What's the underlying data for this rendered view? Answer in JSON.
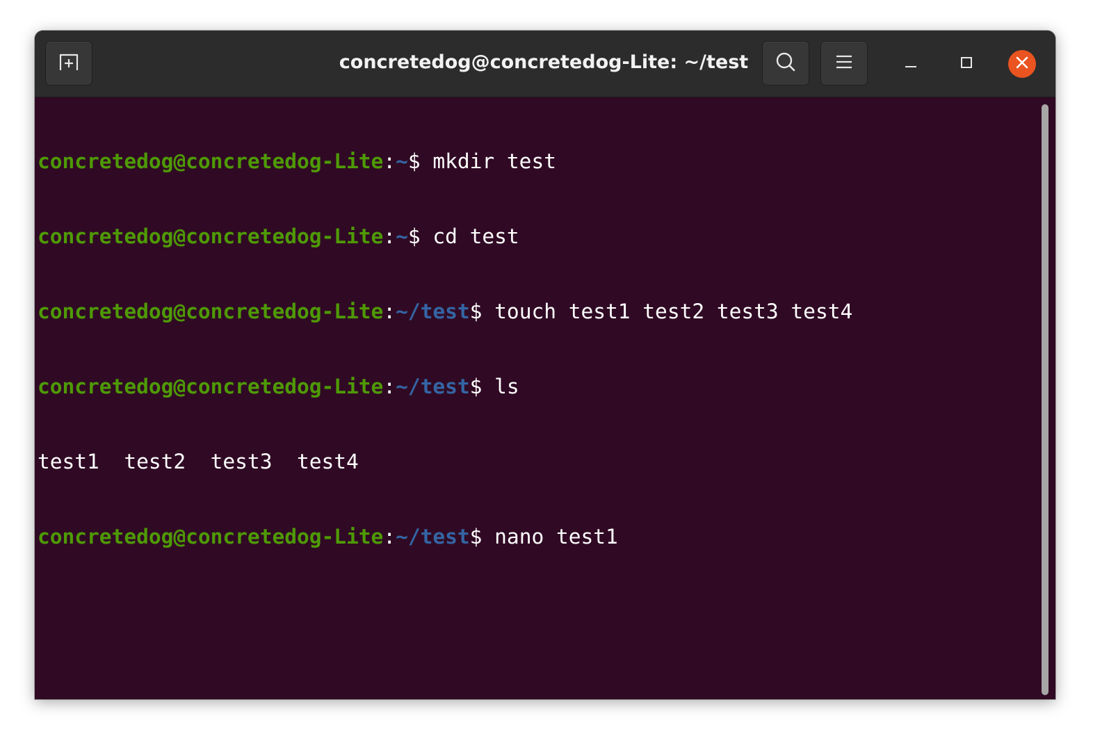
{
  "window": {
    "title": "concretedog@concretedog-Lite: ~/test"
  },
  "headerbar": {
    "new_tab_icon": "new-tab-icon",
    "search_icon": "search-icon",
    "menu_icon": "hamburger-menu-icon",
    "minimize_icon": "minimize-icon",
    "maximize_icon": "maximize-icon",
    "close_icon": "close-icon"
  },
  "colors": {
    "terminal_background": "#300a24",
    "prompt_user": "#4e9a06",
    "prompt_path": "#3465a4",
    "text": "#ffffff",
    "close_button": "#e95420",
    "titlebar": "#2c2c2c"
  },
  "terminal": {
    "lines": [
      {
        "type": "prompt",
        "user": "concretedog@concretedog-Lite",
        "sep": ":",
        "path": "~",
        "symbol": "$",
        "command": " mkdir test"
      },
      {
        "type": "prompt",
        "user": "concretedog@concretedog-Lite",
        "sep": ":",
        "path": "~",
        "symbol": "$",
        "command": " cd test"
      },
      {
        "type": "prompt",
        "user": "concretedog@concretedog-Lite",
        "sep": ":",
        "path": "~/test",
        "symbol": "$",
        "command": " touch test1 test2 test3 test4"
      },
      {
        "type": "prompt",
        "user": "concretedog@concretedog-Lite",
        "sep": ":",
        "path": "~/test",
        "symbol": "$",
        "command": " ls"
      },
      {
        "type": "output",
        "text": "test1  test2  test3  test4"
      },
      {
        "type": "prompt",
        "user": "concretedog@concretedog-Lite",
        "sep": ":",
        "path": "~/test",
        "symbol": "$",
        "command": " nano test1"
      }
    ]
  }
}
